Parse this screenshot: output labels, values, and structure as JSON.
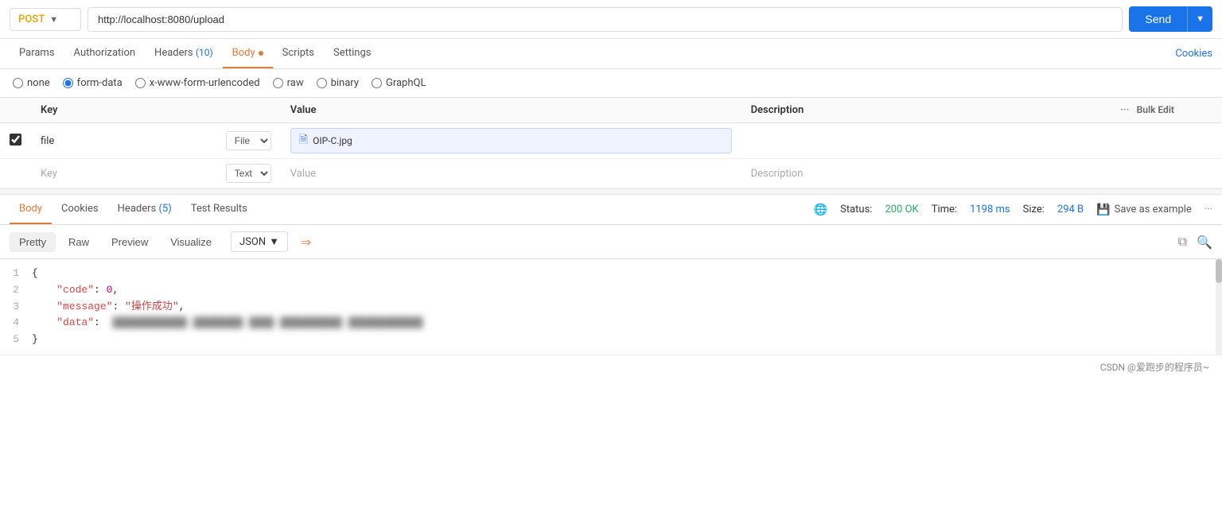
{
  "topbar": {
    "method": "POST",
    "url": "http://localhost:8080/upload",
    "send_label": "Send"
  },
  "request_tabs": [
    {
      "label": "Params",
      "active": false,
      "badge": ""
    },
    {
      "label": "Authorization",
      "active": false,
      "badge": ""
    },
    {
      "label": "Headers",
      "active": false,
      "badge": "(10)"
    },
    {
      "label": "Body",
      "active": true,
      "badge": "",
      "dot": true
    },
    {
      "label": "Scripts",
      "active": false,
      "badge": ""
    },
    {
      "label": "Settings",
      "active": false,
      "badge": ""
    }
  ],
  "cookies_link": "Cookies",
  "body_types": [
    {
      "id": "none",
      "label": "none",
      "checked": false
    },
    {
      "id": "form-data",
      "label": "form-data",
      "checked": true
    },
    {
      "id": "x-www-form-urlencoded",
      "label": "x-www-form-urlencoded",
      "checked": false
    },
    {
      "id": "raw",
      "label": "raw",
      "checked": false
    },
    {
      "id": "binary",
      "label": "binary",
      "checked": false
    },
    {
      "id": "graphql",
      "label": "GraphQL",
      "checked": false
    }
  ],
  "table": {
    "headers": [
      "Key",
      "Value",
      "Description"
    ],
    "bulk_edit": "Bulk Edit",
    "rows": [
      {
        "checked": true,
        "key": "file",
        "type": "File",
        "value": "OIP-C.jpg",
        "description": ""
      }
    ],
    "empty_row": {
      "key_placeholder": "Key",
      "type": "Text",
      "value_placeholder": "Value",
      "description_placeholder": "Description"
    }
  },
  "response": {
    "tabs": [
      {
        "label": "Body",
        "active": true
      },
      {
        "label": "Cookies",
        "active": false
      },
      {
        "label": "Headers",
        "active": false,
        "badge": "(5)"
      },
      {
        "label": "Test Results",
        "active": false
      }
    ],
    "status_label": "Status:",
    "status_value": "200 OK",
    "time_label": "Time:",
    "time_value": "1198 ms",
    "size_label": "Size:",
    "size_value": "294 B",
    "save_label": "Save as example"
  },
  "format_bar": {
    "tabs": [
      "Pretty",
      "Raw",
      "Preview",
      "Visualize"
    ],
    "active_tab": "Pretty",
    "format": "JSON"
  },
  "code": {
    "lines": [
      {
        "num": 1,
        "content": "{",
        "type": "brace"
      },
      {
        "num": 2,
        "content": "    \"code\": 0,",
        "type": "mixed"
      },
      {
        "num": 3,
        "content": "    \"message\": \"操作成功\",",
        "type": "mixed"
      },
      {
        "num": 4,
        "content": "    \"data\":  [blurred content]",
        "type": "blur"
      },
      {
        "num": 5,
        "content": "}",
        "type": "brace"
      }
    ]
  },
  "watermark": "CSDN @爱跑步的程序员~"
}
